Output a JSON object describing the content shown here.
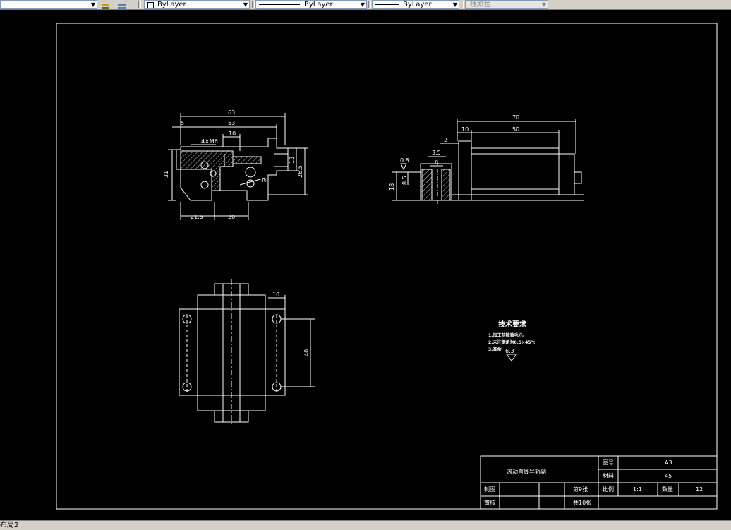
{
  "toolbar": {
    "layer_box_value": "ByLayer",
    "linetype_box_value": "ByLayer",
    "lineweight_box_value": "ByLayer",
    "plotstyle_box_value": "随颜色"
  },
  "status": {
    "layout_tab": "布局2"
  },
  "dims": {
    "d63": "63",
    "d5": "5",
    "d53": "53",
    "d10a": "10",
    "d4xm6": "4×M6",
    "d31": "31",
    "d13": "13",
    "d26_5": "26.5",
    "d21_5": "21.5",
    "d20": "20",
    "d70": "70",
    "d50": "50",
    "d10b": "10",
    "d2": "2",
    "d3_5": "3.5",
    "d6": "6",
    "d0_8": "0.8",
    "d8_5": "8.5",
    "d18": "18",
    "d10c": "10",
    "d40": "40",
    "d40deg": "40",
    "d6_3": "6.3"
  },
  "tech": {
    "title": "技术要求",
    "line1": "1.加工前检验毛坯。",
    "line2": "2.未注倒角为0.5×45°；",
    "line3": "3.其余"
  },
  "titleblock": {
    "name": "滚动直线导轨副",
    "tuhao_label": "图号",
    "tuhao": "A3",
    "cailiao_label": "材料",
    "cailiao": "45",
    "zhitu": "制图",
    "shenhe": "审核",
    "sheet": "第9张",
    "total": "共10张",
    "bili_label": "比例",
    "bili": "1:1",
    "shuliang_label": "数量",
    "shuliang": "12"
  }
}
